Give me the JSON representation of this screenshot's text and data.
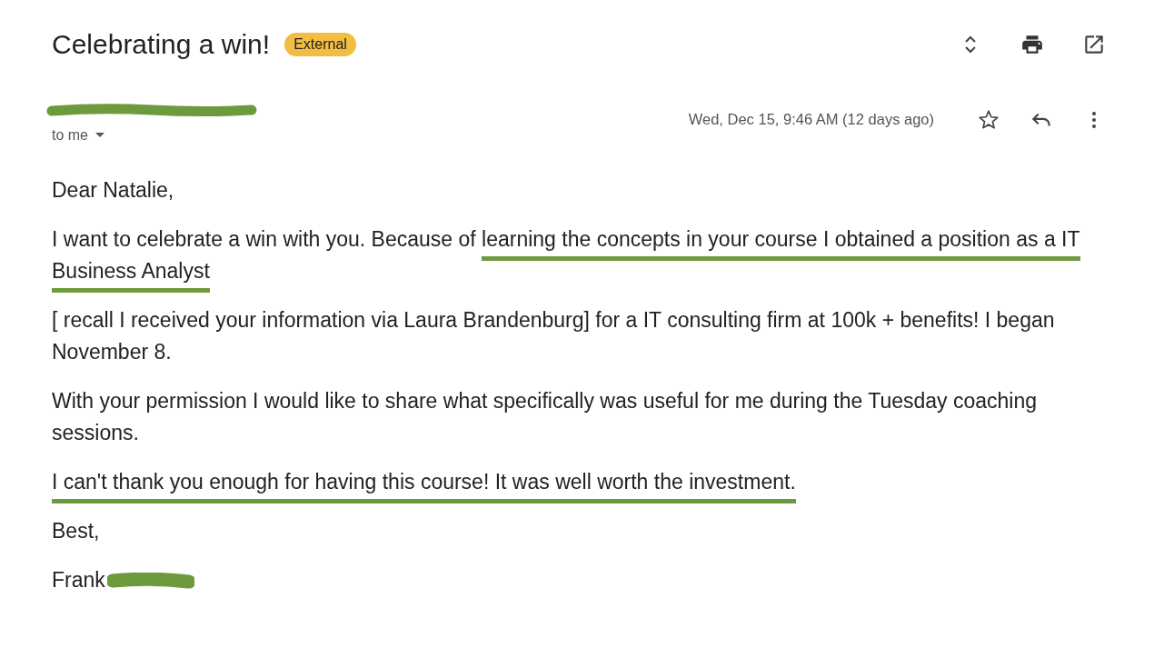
{
  "email": {
    "subject": "Celebrating a win!",
    "label": "External",
    "recipient": "to me",
    "date": "Wed, Dec 15, 9:46 AM (12 days ago)",
    "starred": false
  },
  "body": [
    {
      "segments": [
        {
          "text": "Dear Natalie,",
          "underlined": false
        }
      ]
    },
    {
      "segments": [
        {
          "text": "I want to celebrate a win with you. Because of ",
          "underlined": false
        },
        {
          "text": "learning the concepts in your course I obtained a position as a IT Business Analyst",
          "underlined": true
        }
      ]
    },
    {
      "segments": [
        {
          "text": "[ recall I received your information via Laura Brandenburg] for a IT consulting firm at 100k + benefits! I began November 8.",
          "underlined": false
        }
      ]
    },
    {
      "segments": [
        {
          "text": "With your permission I would like to share what specifically was useful for me during the Tuesday coaching sessions.",
          "underlined": false
        }
      ]
    },
    {
      "segments": [
        {
          "text": "I can't thank you enough for having this course! It was well worth the investment.",
          "underlined": true
        }
      ]
    },
    {
      "segments": [
        {
          "text": "Best,",
          "underlined": false
        }
      ]
    }
  ],
  "signature": "Frank"
}
